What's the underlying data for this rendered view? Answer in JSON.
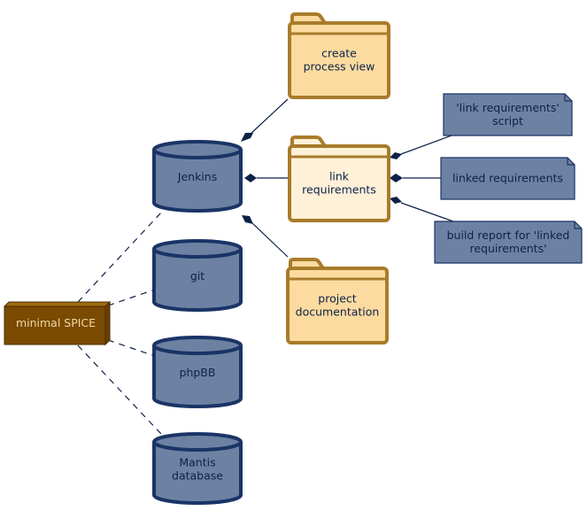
{
  "diagram": {
    "node": {
      "label": "minimal SPICE",
      "color": "#7a4a00"
    },
    "databases": [
      {
        "id": "jenkins",
        "label": [
          "Jenkins"
        ]
      },
      {
        "id": "git",
        "label": [
          "git"
        ]
      },
      {
        "id": "phpbb",
        "label": [
          "phpBB"
        ]
      },
      {
        "id": "mantis",
        "label": [
          "Mantis",
          "database"
        ]
      }
    ],
    "folders": [
      {
        "id": "create-process-view",
        "label": [
          "create",
          "process view"
        ]
      },
      {
        "id": "link-requirements",
        "label": [
          "link",
          "requirements"
        ]
      },
      {
        "id": "project-documentation",
        "label": [
          "project",
          "documentation"
        ]
      }
    ],
    "artifacts": [
      {
        "id": "link-requirements-script",
        "label": [
          "'link requirements'",
          "script"
        ]
      },
      {
        "id": "linked-requirements",
        "label": [
          "linked requirements"
        ]
      },
      {
        "id": "build-report",
        "label": [
          "build report for 'linked",
          "requirements'"
        ]
      }
    ],
    "edges": [
      {
        "from": "minimal SPICE",
        "to": "Jenkins",
        "style": "dashed"
      },
      {
        "from": "minimal SPICE",
        "to": "git",
        "style": "dashed"
      },
      {
        "from": "minimal SPICE",
        "to": "phpBB",
        "style": "dashed"
      },
      {
        "from": "minimal SPICE",
        "to": "Mantis database",
        "style": "dashed"
      },
      {
        "from": "Jenkins",
        "to": "create process view",
        "style": "composition"
      },
      {
        "from": "Jenkins",
        "to": "link requirements",
        "style": "composition"
      },
      {
        "from": "Jenkins",
        "to": "project documentation",
        "style": "composition"
      },
      {
        "from": "link requirements",
        "to": "'link requirements' script",
        "style": "composition"
      },
      {
        "from": "link requirements",
        "to": "linked requirements",
        "style": "composition"
      },
      {
        "from": "link requirements",
        "to": "build report for 'linked requirements'",
        "style": "composition"
      }
    ]
  }
}
